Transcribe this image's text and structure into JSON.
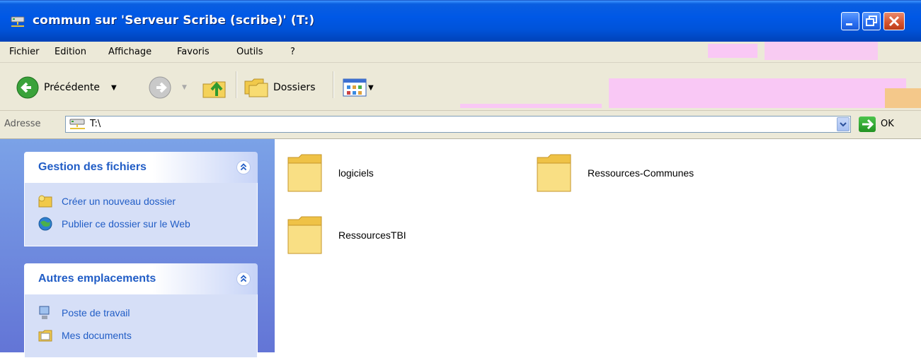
{
  "window": {
    "title": "commun sur 'Serveur Scribe (scribe)' (T:)",
    "title_icon": "network-drive-icon"
  },
  "menu": [
    "Fichier",
    "Edition",
    "Affichage",
    "Favoris",
    "Outils",
    "?"
  ],
  "toolbar": {
    "back_label": "Précédente",
    "folders_label": "Dossiers"
  },
  "address": {
    "label": "Adresse",
    "value": "T:\\",
    "go_label": "OK"
  },
  "panels": {
    "file_tasks": {
      "title": "Gestion des fichiers",
      "items": [
        "Créer un nouveau dossier",
        "Publier ce dossier sur le Web"
      ]
    },
    "other_places": {
      "title": "Autres emplacements",
      "items": [
        "Poste de travail",
        "Mes documents"
      ]
    }
  },
  "files": [
    "logiciels",
    "Ressources-Communes",
    "RessourcesTBI"
  ],
  "colors": {
    "title_blue": "#0058e6",
    "task_link": "#215dc6",
    "chrome": "#ece9d8"
  }
}
